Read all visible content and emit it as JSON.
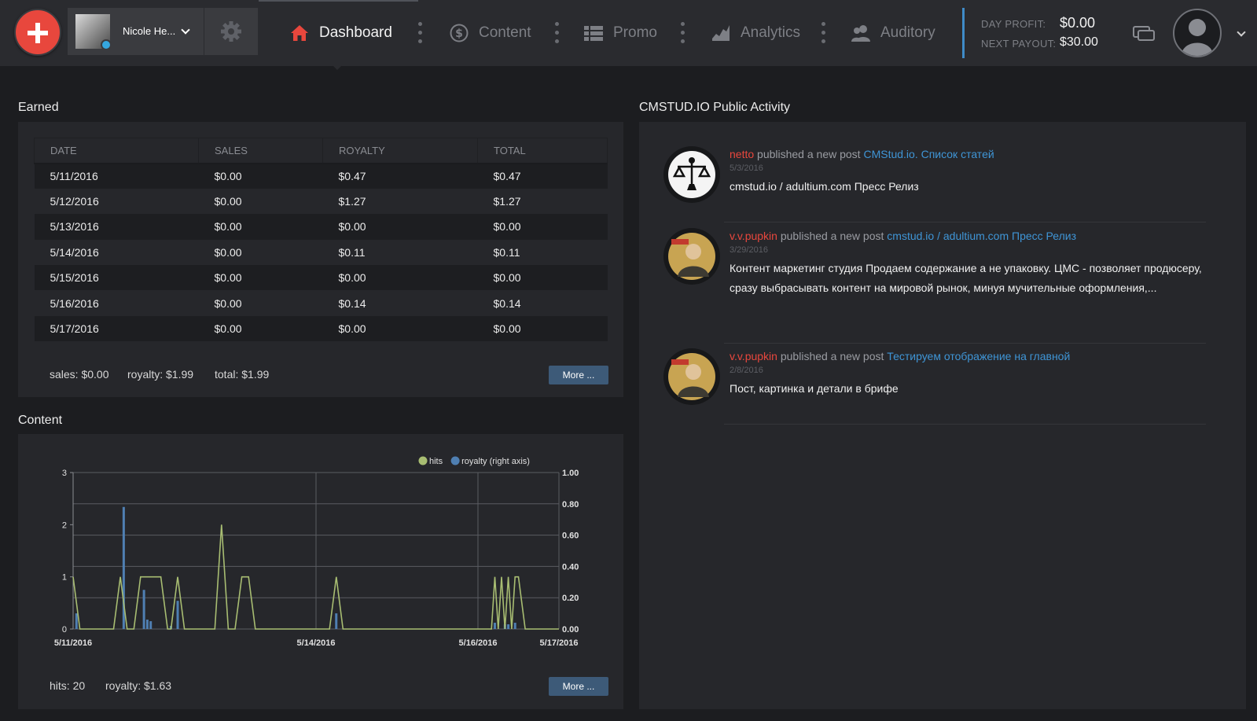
{
  "header": {
    "user_name": "Nicole He...",
    "nav": [
      {
        "label": "Dashboard",
        "icon": "home-icon",
        "active": true
      },
      {
        "label": "Content",
        "icon": "dollar-coin-icon",
        "active": false
      },
      {
        "label": "Promo",
        "icon": "list-icon",
        "active": false
      },
      {
        "label": "Analytics",
        "icon": "area-chart-icon",
        "active": false
      },
      {
        "label": "Auditory",
        "icon": "users-icon",
        "active": false
      }
    ],
    "day_profit_label": "DAY PROFIT:",
    "day_profit_value": "$0.00",
    "next_payout_label": "NEXT PAYOUT:",
    "next_payout_value": "$30.00",
    "colors": {
      "accent": "#e8473d",
      "link": "#3f95d6",
      "profit_separator": "#3f8bc8"
    }
  },
  "earned": {
    "title": "Earned",
    "columns": [
      "DATE",
      "SALES",
      "ROYALTY",
      "TOTAL"
    ],
    "rows": [
      [
        "5/11/2016",
        "$0.00",
        "$0.47",
        "$0.47"
      ],
      [
        "5/12/2016",
        "$0.00",
        "$1.27",
        "$1.27"
      ],
      [
        "5/13/2016",
        "$0.00",
        "$0.00",
        "$0.00"
      ],
      [
        "5/14/2016",
        "$0.00",
        "$0.11",
        "$0.11"
      ],
      [
        "5/15/2016",
        "$0.00",
        "$0.00",
        "$0.00"
      ],
      [
        "5/16/2016",
        "$0.00",
        "$0.14",
        "$0.14"
      ],
      [
        "5/17/2016",
        "$0.00",
        "$0.00",
        "$0.00"
      ]
    ],
    "summary": {
      "sales": "sales: $0.00",
      "royalty": "royalty: $1.99",
      "total": "total: $1.99"
    },
    "more_label": "More ..."
  },
  "content": {
    "title": "Content",
    "summary": {
      "hits": "hits: 20",
      "royalty": "royalty: $1.63"
    },
    "more_label": "More ..."
  },
  "chart_data": {
    "type": "line",
    "title": "",
    "legend": [
      {
        "name": "hits",
        "color": "#a8bd72"
      },
      {
        "name": "royalty (right axis)",
        "color": "#4f7fb2"
      }
    ],
    "legend_position": "top-right",
    "x_ticks": [
      "5/11/2016",
      "5/14/2016",
      "5/16/2016",
      "5/17/2016"
    ],
    "x_range": [
      "5/11/2016",
      "5/17/2016"
    ],
    "y_left": {
      "ticks": [
        0,
        1,
        2,
        3
      ],
      "range": [
        0,
        3
      ]
    },
    "y_right": {
      "ticks": [
        "0.00",
        "0.20",
        "0.40",
        "0.60",
        "0.80",
        "1.00"
      ],
      "range": [
        0,
        1
      ]
    },
    "grid": true,
    "series": [
      {
        "name": "hits",
        "points": [
          [
            "5/11/2016 00:00",
            1
          ],
          [
            "5/11/2016 02:00",
            0
          ],
          [
            "5/11/2016 12:00",
            0
          ],
          [
            "5/11/2016 14:00",
            1
          ],
          [
            "5/11/2016 16:00",
            0
          ],
          [
            "5/11/2016 18:00",
            0
          ],
          [
            "5/11/2016 20:00",
            1
          ],
          [
            "5/12/2016 02:00",
            1
          ],
          [
            "5/12/2016 04:00",
            0
          ],
          [
            "5/12/2016 05:00",
            0
          ],
          [
            "5/12/2016 07:00",
            1
          ],
          [
            "5/12/2016 09:00",
            0
          ],
          [
            "5/12/2016 18:00",
            0
          ],
          [
            "5/12/2016 20:00",
            2
          ],
          [
            "5/12/2016 22:00",
            0
          ],
          [
            "5/13/2016 00:00",
            0
          ],
          [
            "5/13/2016 02:00",
            1
          ],
          [
            "5/13/2016 04:00",
            1
          ],
          [
            "5/13/2016 06:00",
            0
          ],
          [
            "5/14/2016 04:00",
            0
          ],
          [
            "5/14/2016 06:00",
            1
          ],
          [
            "5/14/2016 08:00",
            0
          ],
          [
            "5/16/2016 04:00",
            0
          ],
          [
            "5/16/2016 05:00",
            1
          ],
          [
            "5/16/2016 06:00",
            0
          ],
          [
            "5/16/2016 07:00",
            1
          ],
          [
            "5/16/2016 08:00",
            0
          ],
          [
            "5/16/2016 09:00",
            1
          ],
          [
            "5/16/2016 10:00",
            0
          ],
          [
            "5/16/2016 11:00",
            1
          ],
          [
            "5/16/2016 12:00",
            1
          ],
          [
            "5/16/2016 14:00",
            0
          ],
          [
            "5/17/2016 00:00",
            0
          ]
        ]
      },
      {
        "name": "royalty (right axis)",
        "bars": [
          [
            "5/11/2016 01:00",
            0.1
          ],
          [
            "5/11/2016 15:00",
            0.78
          ],
          [
            "5/11/2016 21:00",
            0.25
          ],
          [
            "5/11/2016 22:00",
            0.06
          ],
          [
            "5/11/2016 23:00",
            0.05
          ],
          [
            "5/12/2016 05:00",
            0.02
          ],
          [
            "5/12/2016 07:00",
            0.18
          ],
          [
            "5/14/2016 06:00",
            0.1
          ],
          [
            "5/16/2016 05:00",
            0.04
          ],
          [
            "5/16/2016 08:00",
            0.03
          ],
          [
            "5/16/2016 09:00",
            0.03
          ],
          [
            "5/16/2016 11:00",
            0.04
          ]
        ]
      }
    ]
  },
  "activity": {
    "title": "CMSTUD.IO Public Activity",
    "items": [
      {
        "user": "netto",
        "verb": "published a new post",
        "link": "CMStud.io. Список статей",
        "date": "5/3/2016",
        "body": "cmstud.io / adultium.com Пресс Релиз"
      },
      {
        "user": "v.v.pupkin",
        "verb": "published a new post",
        "link": "cmstud.io / adultium.com Пресс Релиз",
        "date": "3/29/2016",
        "body": "Контент маркетинг студия   Продаем содержание а не упаковку.  ЦМС - позволяет продюсеру, сразу выбрасывать контент на мировой рынок, минуя мучительные оформления,..."
      },
      {
        "user": "v.v.pupkin",
        "verb": "published a new post",
        "link": "Тестируем отображение на главной",
        "date": "2/8/2016",
        "body": "Пост, картинка и детали в брифе"
      }
    ]
  }
}
